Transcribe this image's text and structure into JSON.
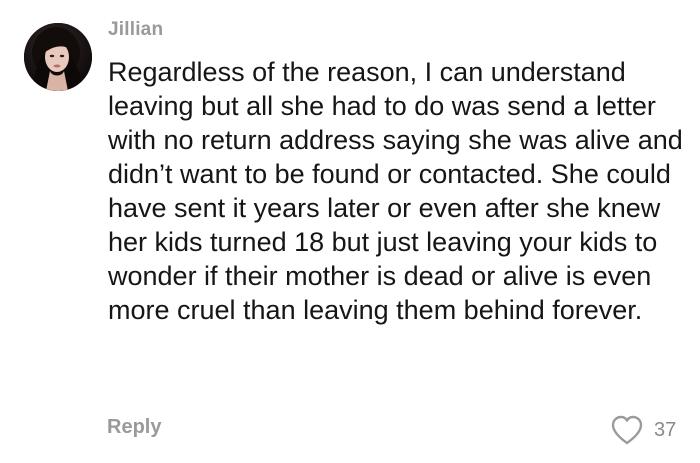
{
  "comment": {
    "author": "Jillian",
    "text": "Regardless of the reason, I can understand leaving but all she had to do was send a letter with no return address saying she was alive and didn’t want to be found or contacted. She could have sent it years later or even after she knew her kids turned 18 but just leaving your kids to wonder if their mother is dead or alive is even more cruel than leaving them behind forever.",
    "avatar_icon": "user-avatar",
    "actions": {
      "reply_label": "Reply",
      "like_icon": "heart-outline-icon",
      "like_count": "37"
    }
  },
  "colors": {
    "text": "#161616",
    "muted": "#9a9a9a",
    "background": "#ffffff"
  }
}
